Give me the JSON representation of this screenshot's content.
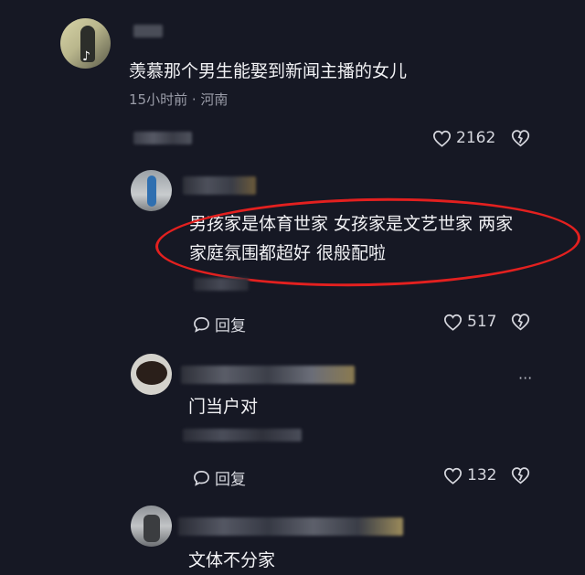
{
  "comments": [
    {
      "text": "羡慕那个男生能娶到新闻主播的女儿",
      "meta": "15小时前 · 河南",
      "like_count": "2162"
    },
    {
      "text_line1": "男孩家是体育世家  女孩家是文艺世家  两家",
      "text_line2": "家庭氛围都超好  很般配啦",
      "reply_label": "回复",
      "like_count": "517"
    },
    {
      "text": "门当户对",
      "reply_label": "回复",
      "like_count": "132",
      "more_label": "···"
    },
    {
      "text": "文体不分家"
    }
  ],
  "colors": {
    "background": "#161824",
    "annotation": "#e3201f"
  }
}
